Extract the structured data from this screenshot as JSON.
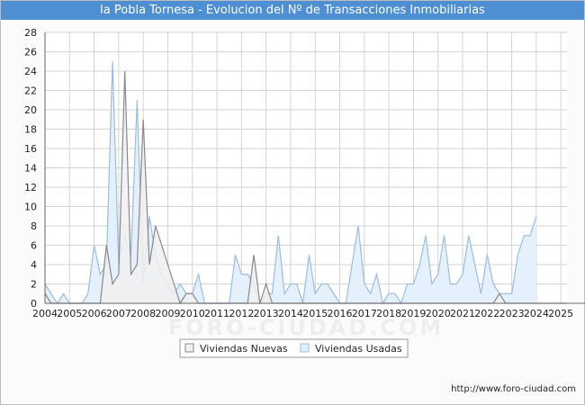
{
  "chart_data": {
    "type": "area",
    "title": "la Pobla Tornesa - Evolucion del Nº de Transacciones Inmobiliarias",
    "x_tick_labels": [
      "2004",
      "2005",
      "2006",
      "2007",
      "2008",
      "2009",
      "2010",
      "2011",
      "2012",
      "2013",
      "2014",
      "2015",
      "2016",
      "2017",
      "2018",
      "2019",
      "2020",
      "2021",
      "2022",
      "2023",
      "2024",
      "2025"
    ],
    "y_ticks": [
      0,
      2,
      4,
      6,
      8,
      10,
      12,
      14,
      16,
      18,
      20,
      22,
      24,
      26,
      28
    ],
    "ylim": [
      0,
      28
    ],
    "xlim": [
      2004,
      2025.25
    ],
    "grid": true,
    "legend_position": "bottom",
    "series": [
      {
        "name": "Viviendas Nuevas",
        "color": "#888888",
        "fill": "#f0f0f0",
        "values": [
          1,
          0,
          0,
          0,
          0,
          0,
          0,
          0,
          0,
          0,
          6,
          2,
          3,
          24,
          3,
          4,
          19,
          4,
          8,
          6,
          4,
          2,
          0,
          1,
          1,
          0,
          0,
          0,
          0,
          0,
          0,
          0,
          0,
          0,
          5,
          0,
          2,
          0,
          0,
          0,
          0,
          0,
          0,
          0,
          0,
          0,
          0,
          0,
          0,
          0,
          0,
          0,
          0,
          0,
          0,
          0,
          0,
          0,
          0,
          0,
          0,
          0,
          0,
          0,
          0,
          0,
          0,
          0,
          0,
          0,
          0,
          0,
          0,
          0,
          1,
          0,
          0,
          0,
          0,
          0,
          0,
          0,
          0,
          0,
          0,
          0,
          0,
          0,
          0
        ]
      },
      {
        "name": "Viviendas Usadas",
        "color": "#9bbde0",
        "fill": "#e4f0fb",
        "values": [
          2,
          1,
          0,
          1,
          0,
          0,
          0,
          1,
          6,
          3,
          4,
          25,
          4,
          7,
          5,
          21,
          2,
          9,
          5,
          3,
          2,
          1,
          2,
          1,
          1,
          3,
          0,
          0,
          0,
          0,
          0,
          5,
          3,
          3,
          2,
          0,
          1,
          1,
          7,
          1,
          2,
          2,
          0,
          5,
          1,
          2,
          2,
          1,
          0,
          0,
          4,
          8,
          2,
          1,
          3,
          0,
          1,
          1,
          0,
          2,
          2,
          4,
          7,
          2,
          3,
          7,
          2,
          2,
          3,
          7,
          4,
          1,
          5,
          2,
          1,
          1,
          1,
          5,
          7,
          7,
          9
        ]
      }
    ]
  },
  "watermark": "FORO-CIUDAD.COM",
  "credit": "http://www.foro-ciudad.com"
}
